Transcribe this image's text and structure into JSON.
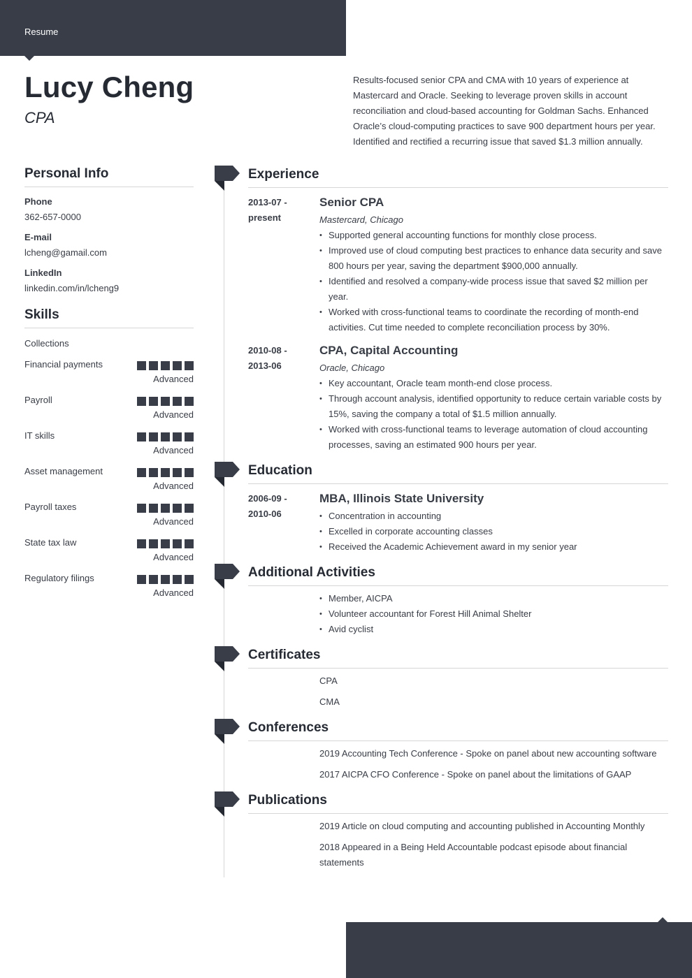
{
  "header": {
    "doc_label": "Resume"
  },
  "profile": {
    "name": "Lucy Cheng",
    "title": "CPA",
    "summary": "Results-focused senior CPA and CMA with 10 years of experience at Mastercard and Oracle. Seeking to leverage proven skills in account reconciliation and cloud-based accounting for Goldman Sachs. Enhanced Oracle’s cloud-computing practices to save 900 department hours per year. Identified and rectified a recurring issue that saved $1.3 million annually."
  },
  "personal_info": {
    "heading": "Personal Info",
    "fields": [
      {
        "label": "Phone",
        "value": "362-657-0000"
      },
      {
        "label": "E-mail",
        "value": "lcheng@gamail.com"
      },
      {
        "label": "LinkedIn",
        "value": "linkedin.com/in/lcheng9"
      }
    ]
  },
  "skills": {
    "heading": "Skills",
    "plain": [
      "Collections"
    ],
    "rated": [
      {
        "name": "Financial payments",
        "rating": 5,
        "max": 5,
        "level": "Advanced"
      },
      {
        "name": "Payroll",
        "rating": 5,
        "max": 5,
        "level": "Advanced"
      },
      {
        "name": "IT skills",
        "rating": 5,
        "max": 5,
        "level": "Advanced"
      },
      {
        "name": "Asset management",
        "rating": 5,
        "max": 5,
        "level": "Advanced"
      },
      {
        "name": "Payroll taxes",
        "rating": 5,
        "max": 5,
        "level": "Advanced"
      },
      {
        "name": "State tax law",
        "rating": 5,
        "max": 5,
        "level": "Advanced"
      },
      {
        "name": "Regulatory filings",
        "rating": 5,
        "max": 5,
        "level": "Advanced"
      }
    ]
  },
  "experience": {
    "heading": "Experience",
    "items": [
      {
        "date_start": "2013-07 -",
        "date_end": "present",
        "title": "Senior CPA",
        "company": "Mastercard, Chicago",
        "bullets": [
          "Supported general accounting functions for monthly close process.",
          "Improved use of cloud computing best practices to enhance data security and save 800 hours per year, saving the department $900,000 annually.",
          "Identified and resolved a company-wide process issue that saved $2 million per year.",
          "Worked with cross-functional teams to coordinate the recording of month-end activities. Cut time needed to complete reconciliation process by 30%."
        ]
      },
      {
        "date_start": "2010-08 -",
        "date_end": "2013-06",
        "title": "CPA, Capital Accounting",
        "company": "Oracle, Chicago",
        "bullets": [
          "Key accountant, Oracle team month-end close process.",
          "Through account analysis, identified opportunity to reduce certain variable costs by 15%, saving the company a total of $1.5 million annually.",
          "Worked with cross-functional teams to leverage automation of cloud accounting processes, saving an estimated 900 hours per year."
        ]
      }
    ]
  },
  "education": {
    "heading": "Education",
    "items": [
      {
        "date_start": "2006-09 -",
        "date_end": "2010-06",
        "title": "MBA, Illinois State University",
        "bullets": [
          "Concentration in accounting",
          "Excelled in corporate accounting classes",
          "Received the Academic Achievement award in my senior year"
        ]
      }
    ]
  },
  "activities": {
    "heading": "Additional Activities",
    "bullets": [
      "Member, AICPA",
      "Volunteer accountant for Forest Hill Animal Shelter",
      "Avid cyclist"
    ]
  },
  "certificates": {
    "heading": "Certificates",
    "items": [
      "CPA",
      "CMA"
    ]
  },
  "conferences": {
    "heading": "Conferences",
    "items": [
      "2019 Accounting Tech Conference - Spoke on panel about new accounting software",
      "2017 AICPA CFO Conference - Spoke on panel about the limitations of GAAP"
    ]
  },
  "publications": {
    "heading": "Publications",
    "items": [
      "2019 Article on cloud computing and accounting published in Accounting Monthly",
      "2018 Appeared in a Being Held Accountable podcast episode about financial statements"
    ]
  },
  "colors": {
    "accent_dark": "#383d48",
    "text": "#383c45",
    "heading": "#262a33",
    "rule": "#d6d6d6"
  }
}
